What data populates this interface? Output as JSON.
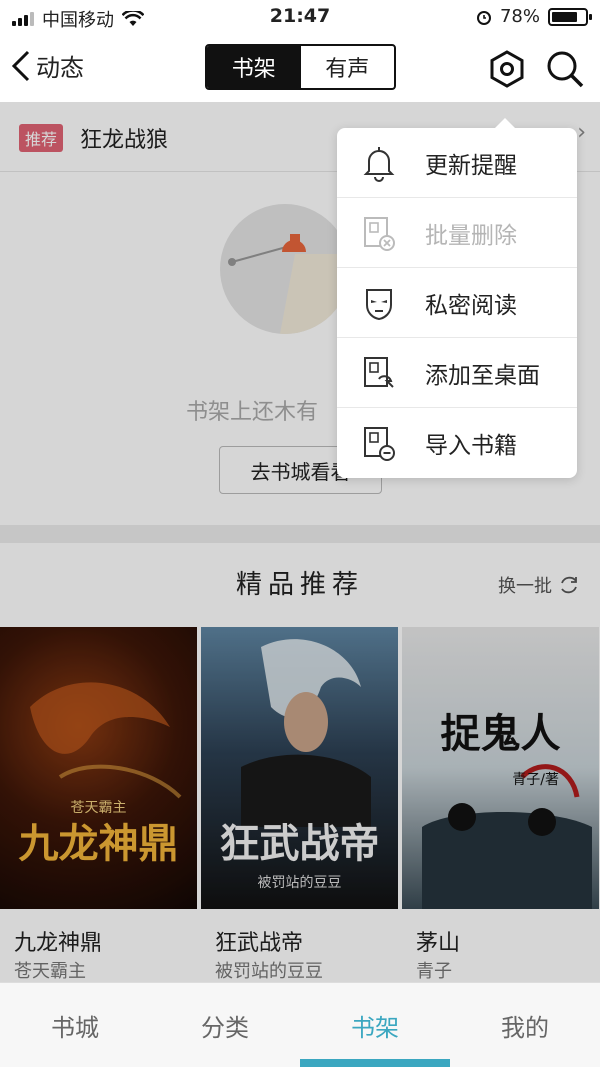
{
  "status_bar": {
    "carrier": "中国移动",
    "time": "21:47",
    "battery_percent": "78%",
    "battery_level": 0.78
  },
  "nav": {
    "back_label": "动态",
    "tabs": [
      "书架",
      "有声"
    ],
    "active_tab": "书架"
  },
  "recommend_bar": {
    "tag": "推荐",
    "title": "狂龙战狼"
  },
  "empty_state": {
    "text": "书架上还木有",
    "button": "去书城看看"
  },
  "section": {
    "title": "精品推荐",
    "refresh": "换一批"
  },
  "books": [
    {
      "name": "九龙神鼎",
      "author": "苍天霸主",
      "cover_title": "九龙神鼎",
      "cover_author": "苍天霸主"
    },
    {
      "name": "狂武战帝",
      "author": "被罚站的豆豆",
      "cover_title": "狂武战帝",
      "cover_author": "被罚站的豆豆"
    },
    {
      "name": "茅山",
      "author": "青子",
      "cover_title": "捉鬼人",
      "cover_author": "青子/著"
    }
  ],
  "menu": {
    "items": [
      {
        "label": "更新提醒",
        "icon": "bell-icon",
        "enabled": true
      },
      {
        "label": "批量删除",
        "icon": "batch-delete-icon",
        "enabled": false
      },
      {
        "label": "私密阅读",
        "icon": "mask-icon",
        "enabled": true
      },
      {
        "label": "添加至桌面",
        "icon": "add-to-desktop-icon",
        "enabled": true
      },
      {
        "label": "导入书籍",
        "icon": "import-book-icon",
        "enabled": true
      }
    ]
  },
  "tabbar": {
    "items": [
      "书城",
      "分类",
      "书架",
      "我的"
    ],
    "active": "书架"
  },
  "colors": {
    "accent": "#3ba7c0",
    "tag": "#e06474"
  }
}
